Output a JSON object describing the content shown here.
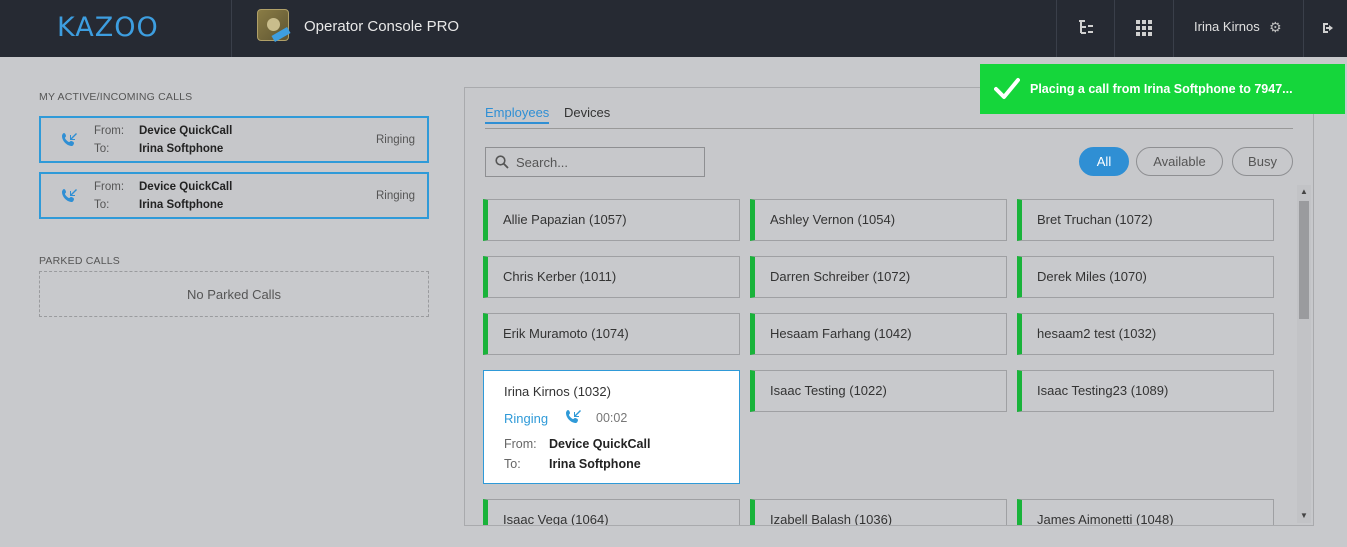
{
  "header": {
    "logo": "KAZOO",
    "app_title": "Operator Console PRO",
    "user_name": "Irina Kirnos"
  },
  "left": {
    "active_calls_label": "MY ACTIVE/INCOMING CALLS",
    "calls": [
      {
        "from_label": "From:",
        "from": "Device QuickCall",
        "to_label": "To:",
        "to": "Irina Softphone",
        "status": "Ringing"
      },
      {
        "from_label": "From:",
        "from": "Device QuickCall",
        "to_label": "To:",
        "to": "Irina Softphone",
        "status": "Ringing"
      }
    ],
    "parked_label": "PARKED CALLS",
    "parked_empty": "No Parked Calls"
  },
  "main": {
    "tabs": [
      {
        "label": "Employees",
        "active": true
      },
      {
        "label": "Devices",
        "active": false
      }
    ],
    "search": {
      "placeholder": "Search..."
    },
    "filters": [
      {
        "label": "All",
        "active": true
      },
      {
        "label": "Available",
        "active": false
      },
      {
        "label": "Busy",
        "active": false
      }
    ],
    "employees": [
      "Allie Papazian (1057)",
      "Ashley Vernon (1054)",
      "Bret Truchan (1072)",
      "Chris Kerber (1011)",
      "Darren Schreiber (1072)",
      "Derek Miles (1070)",
      "Erik Muramoto (1074)",
      "Hesaam Farhang (1042)",
      "hesaam2 test (1032)",
      "Irina Kirnos (1032)",
      "Isaac Testing (1022)",
      "Isaac Testing23 (1089)",
      "Isaac Vega (1064)",
      "Izabell Balash (1036)",
      "James Aimonetti (1048)"
    ],
    "expanded": {
      "status": "Ringing",
      "timer": "00:02",
      "from_label": "From:",
      "from": "Device QuickCall",
      "to_label": "To:",
      "to": "Irina Softphone"
    }
  },
  "toast": {
    "message": "Placing a call from Irina Softphone to 7947..."
  },
  "colors": {
    "accent": "#2f8fd4",
    "available": "#19b33a",
    "toast": "#15d63b",
    "topbar": "#262a33"
  }
}
